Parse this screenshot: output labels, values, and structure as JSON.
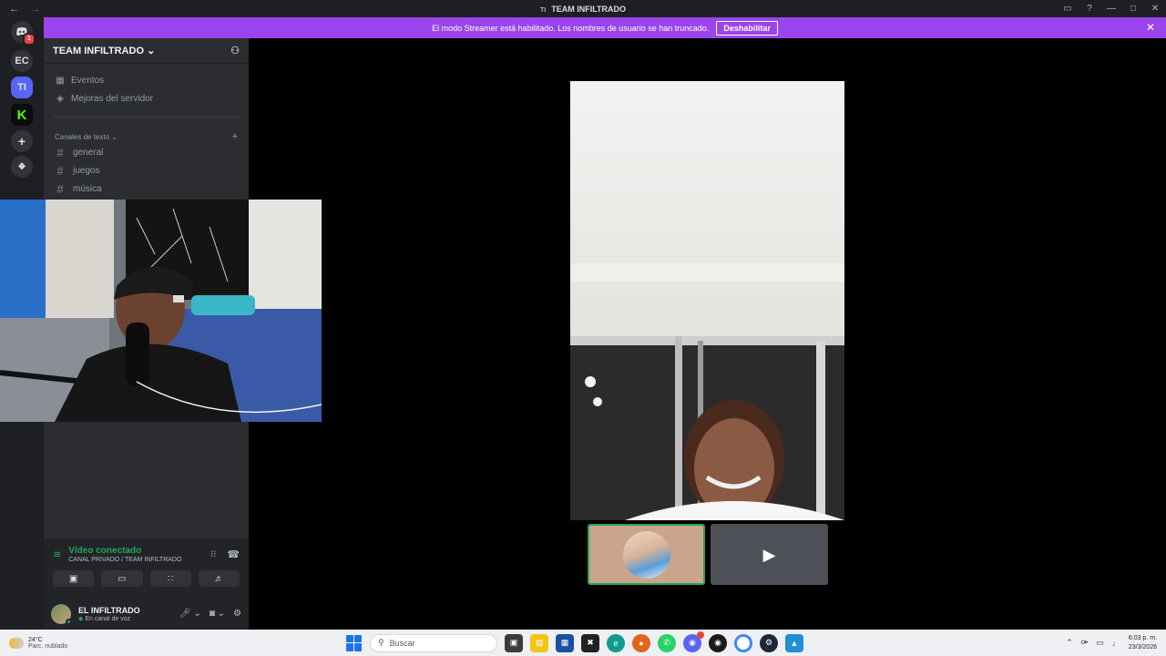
{
  "window": {
    "title": "TEAM INFILTRADO",
    "title_prefix": "TI",
    "back_icon": "arrow-left-icon",
    "forward_icon": "arrow-right-icon"
  },
  "streamer_banner": {
    "text": "El modo Streamer está habilitado. Los nombres de usuario se han truncado.",
    "button": "Deshabilitar",
    "bg_color": "#9b44ed"
  },
  "guilds": [
    {
      "label": "",
      "icon": "discord-logo-icon",
      "badge": "1"
    },
    {
      "label": "EC",
      "icon": "",
      "badge": ""
    },
    {
      "label": "TI",
      "icon": "",
      "badge": ""
    },
    {
      "label": "",
      "icon": "kick-logo-icon",
      "badge": ""
    },
    {
      "label": "+",
      "icon": "add-server-icon",
      "badge": ""
    },
    {
      "label": "",
      "icon": "compass-icon",
      "badge": ""
    }
  ],
  "server": {
    "name": "TEAM INFILTRADO",
    "events": "Eventos",
    "boosts": "Mejoras del servidor",
    "category": "Canales de texto",
    "channels": [
      "general",
      "juegos",
      "música"
    ]
  },
  "voice": {
    "status": "Vídeo conectado",
    "channel": "CANAL PRIVADO / TEAM INFILTRADO",
    "status_color": "#23a55a"
  },
  "user": {
    "name": "EL INFILTRADO",
    "status": "En canal de voz"
  },
  "taskbar": {
    "temp": "24°C",
    "weather": "Parc. nublado",
    "search_placeholder": "Buscar",
    "time": "6:03 p. m.",
    "date": "23/3/2026"
  }
}
